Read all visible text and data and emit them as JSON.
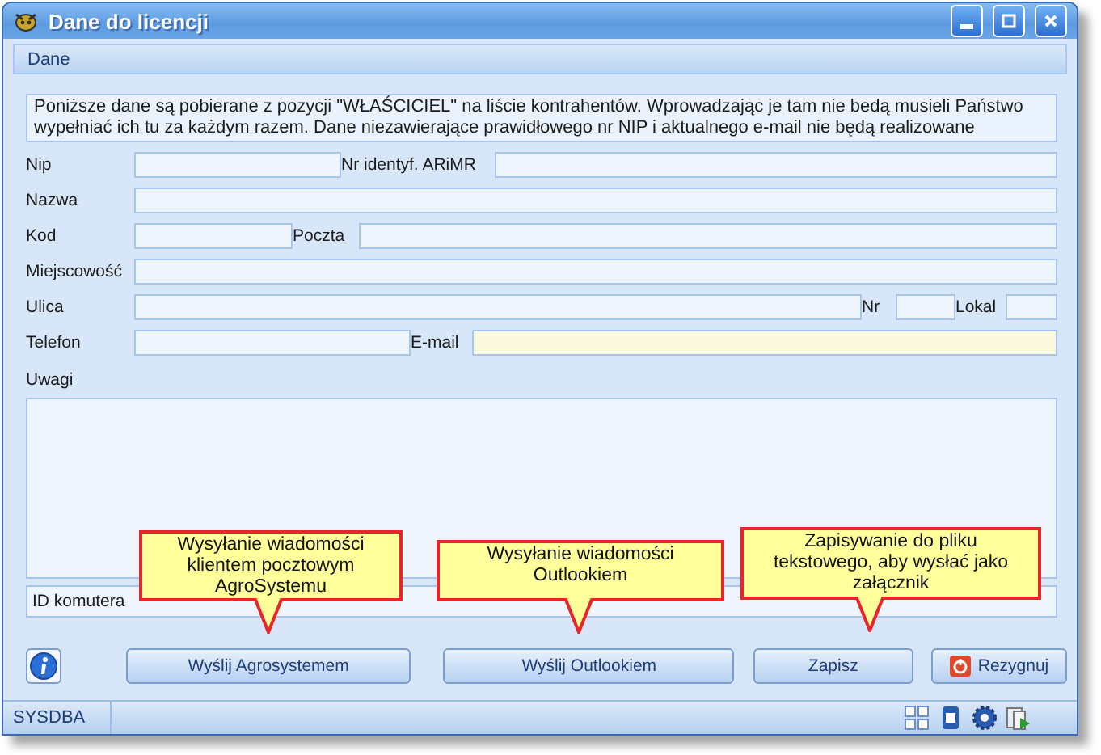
{
  "window": {
    "title": "Dane do licencji"
  },
  "section": {
    "title": "Dane"
  },
  "info_text": "Poniższe dane są pobierane z pozycji \"WŁAŚCICIEL\"  na liście kontrahentów. Wprowadzając je tam nie bedą musieli Państwo wypełniać ich tu za każdym razem. Dane niezawierające prawidłowego nr NIP i aktualnego e-mail nie będą realizowane",
  "form_rows": [
    [
      {
        "label": "Nip",
        "highlighted": false
      },
      {
        "label": "Nr identyf. ARiMR",
        "highlighted": false
      }
    ],
    [
      {
        "label": "Nazwa",
        "highlighted": false
      }
    ],
    [
      {
        "label": "Kod",
        "highlighted": false
      },
      {
        "label": "Poczta",
        "highlighted": false
      }
    ],
    [
      {
        "label": "Miejscowość",
        "highlighted": false
      }
    ],
    [
      {
        "label": "Ulica",
        "highlighted": false
      },
      {
        "label": "Nr",
        "highlighted": false
      },
      {
        "label": "Lokal",
        "highlighted": false
      }
    ],
    [
      {
        "label": "Telefon",
        "highlighted": false
      },
      {
        "label": "E-mail",
        "highlighted": true
      }
    ]
  ],
  "notes": {
    "label": "Uwagi"
  },
  "computer_id": {
    "label": "ID komutera"
  },
  "buttons": [
    {
      "label": "Wyślij Agrosystemem",
      "kind": "plain"
    },
    {
      "label": "Wyślij Outlookiem",
      "kind": "plain"
    },
    {
      "label": "Zapisz",
      "kind": "plain"
    },
    {
      "label": "Rezygnuj",
      "kind": "cancel"
    }
  ],
  "callouts": [
    {
      "lines": [
        "Wysyłanie wiadomości",
        "klientem pocztowym",
        "AgroSystemu"
      ]
    },
    {
      "lines": [
        "Wysyłanie wiadomości",
        "Outlookiem"
      ]
    },
    {
      "lines": [
        "Zapisywanie do pliku",
        "tekstowego, aby wysłać jako",
        "załącznik"
      ]
    }
  ],
  "status_bar": {
    "user": "SYSDBA"
  }
}
